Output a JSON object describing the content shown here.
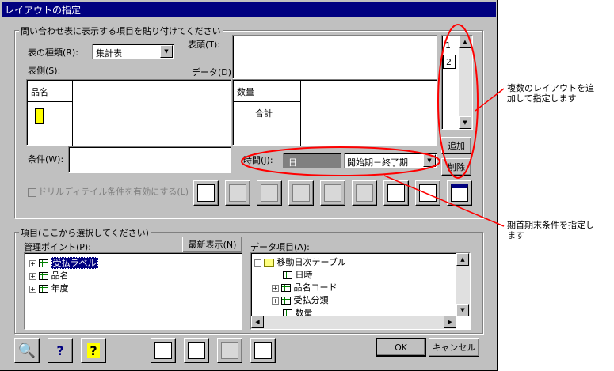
{
  "window": {
    "title": "レイアウトの指定"
  },
  "group_top": {
    "label": "問い合わせ表に表示する項目を貼り付けてください"
  },
  "table_type": {
    "label": "表の種類(R):",
    "value": "集計表"
  },
  "header_label": "表頭(T):",
  "side_label": "表側(S):",
  "data_label": "データ(D):",
  "side_grid": {
    "col1": "品名"
  },
  "data_grid": {
    "col1": "数量",
    "row1": "合計"
  },
  "layout_list": {
    "items": [
      "1",
      "2"
    ],
    "add": "追加",
    "delete": "削除"
  },
  "condition": {
    "label": "条件(W):",
    "value": ""
  },
  "time": {
    "label": "時間(J):",
    "value": "日",
    "period": "開始期－終了期"
  },
  "drill_checkbox": {
    "label": "ドリルディテイル条件を有効にする(L)",
    "checked": false
  },
  "group_bottom": {
    "label": "項目(ここから選択してください)"
  },
  "mgmt": {
    "label": "管理ポイント(P):",
    "refresh": "最新表示(N)",
    "items": [
      "受払ラベル",
      "品名",
      "年度"
    ]
  },
  "data_items": {
    "label": "データ項目(A):",
    "root": "移動日次テーブル",
    "children": [
      "日時",
      "品名コード",
      "受払分類",
      "数量"
    ]
  },
  "buttons": {
    "ok": "OK",
    "cancel": "キャンセル"
  },
  "annotations": {
    "top": "複数のレイアウトを追加して指定します",
    "bottom": "期首期末条件を指定します"
  },
  "colors": {
    "title_bg": "#000080",
    "face": "#c0c0c0",
    "annotation": "#ff0000"
  }
}
